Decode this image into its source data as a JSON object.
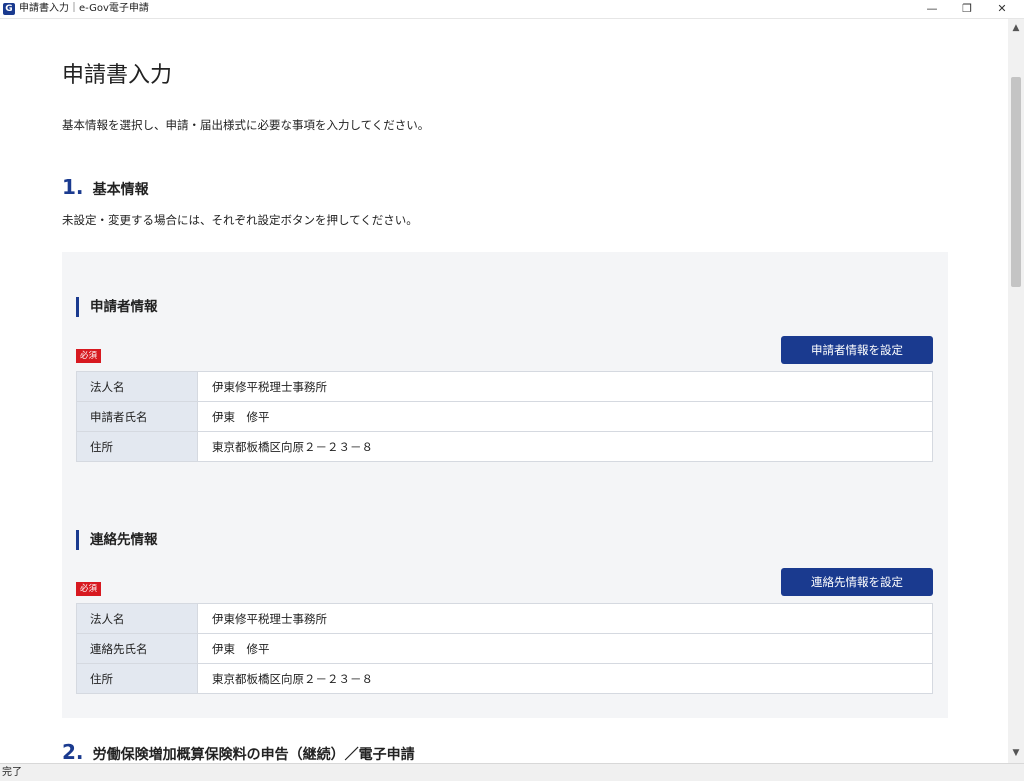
{
  "window": {
    "icon_letter": "G",
    "title": "申請書入力｜e-Gov電子申請",
    "minimize": "—",
    "restore": "❐",
    "close": "✕"
  },
  "page": {
    "title": "申請書入力",
    "description": "基本情報を選択し、申請・届出様式に必要な事項を入力してください。"
  },
  "section1": {
    "number": "1.",
    "title": "基本情報",
    "description": "未設定・変更する場合には、それぞれ設定ボタンを押してください。"
  },
  "applicant": {
    "heading": "申請者情報",
    "required": "必須",
    "button": "申請者情報を設定",
    "rows": [
      {
        "label": "法人名",
        "value": "伊東修平税理士事務所"
      },
      {
        "label": "申請者氏名",
        "value": "伊東　修平"
      },
      {
        "label": "住所",
        "value": "東京都板橋区向原２－２３－８"
      }
    ]
  },
  "contact": {
    "heading": "連絡先情報",
    "required": "必須",
    "button": "連絡先情報を設定",
    "rows": [
      {
        "label": "法人名",
        "value": "伊東修平税理士事務所"
      },
      {
        "label": "連絡先氏名",
        "value": "伊東　修平"
      },
      {
        "label": "住所",
        "value": "東京都板橋区向原２－２３－８"
      }
    ]
  },
  "section2": {
    "number": "2.",
    "title": "労働保険増加概算保険料の申告（継続）／電子申請"
  },
  "scrollbar": {
    "up": "▲",
    "down": "▼"
  },
  "status": {
    "text": "完了"
  },
  "colors": {
    "accent": "#1a3a8f",
    "required": "#d71920",
    "panel": "#f4f5f7",
    "label_cell": "#e3e8f0"
  }
}
